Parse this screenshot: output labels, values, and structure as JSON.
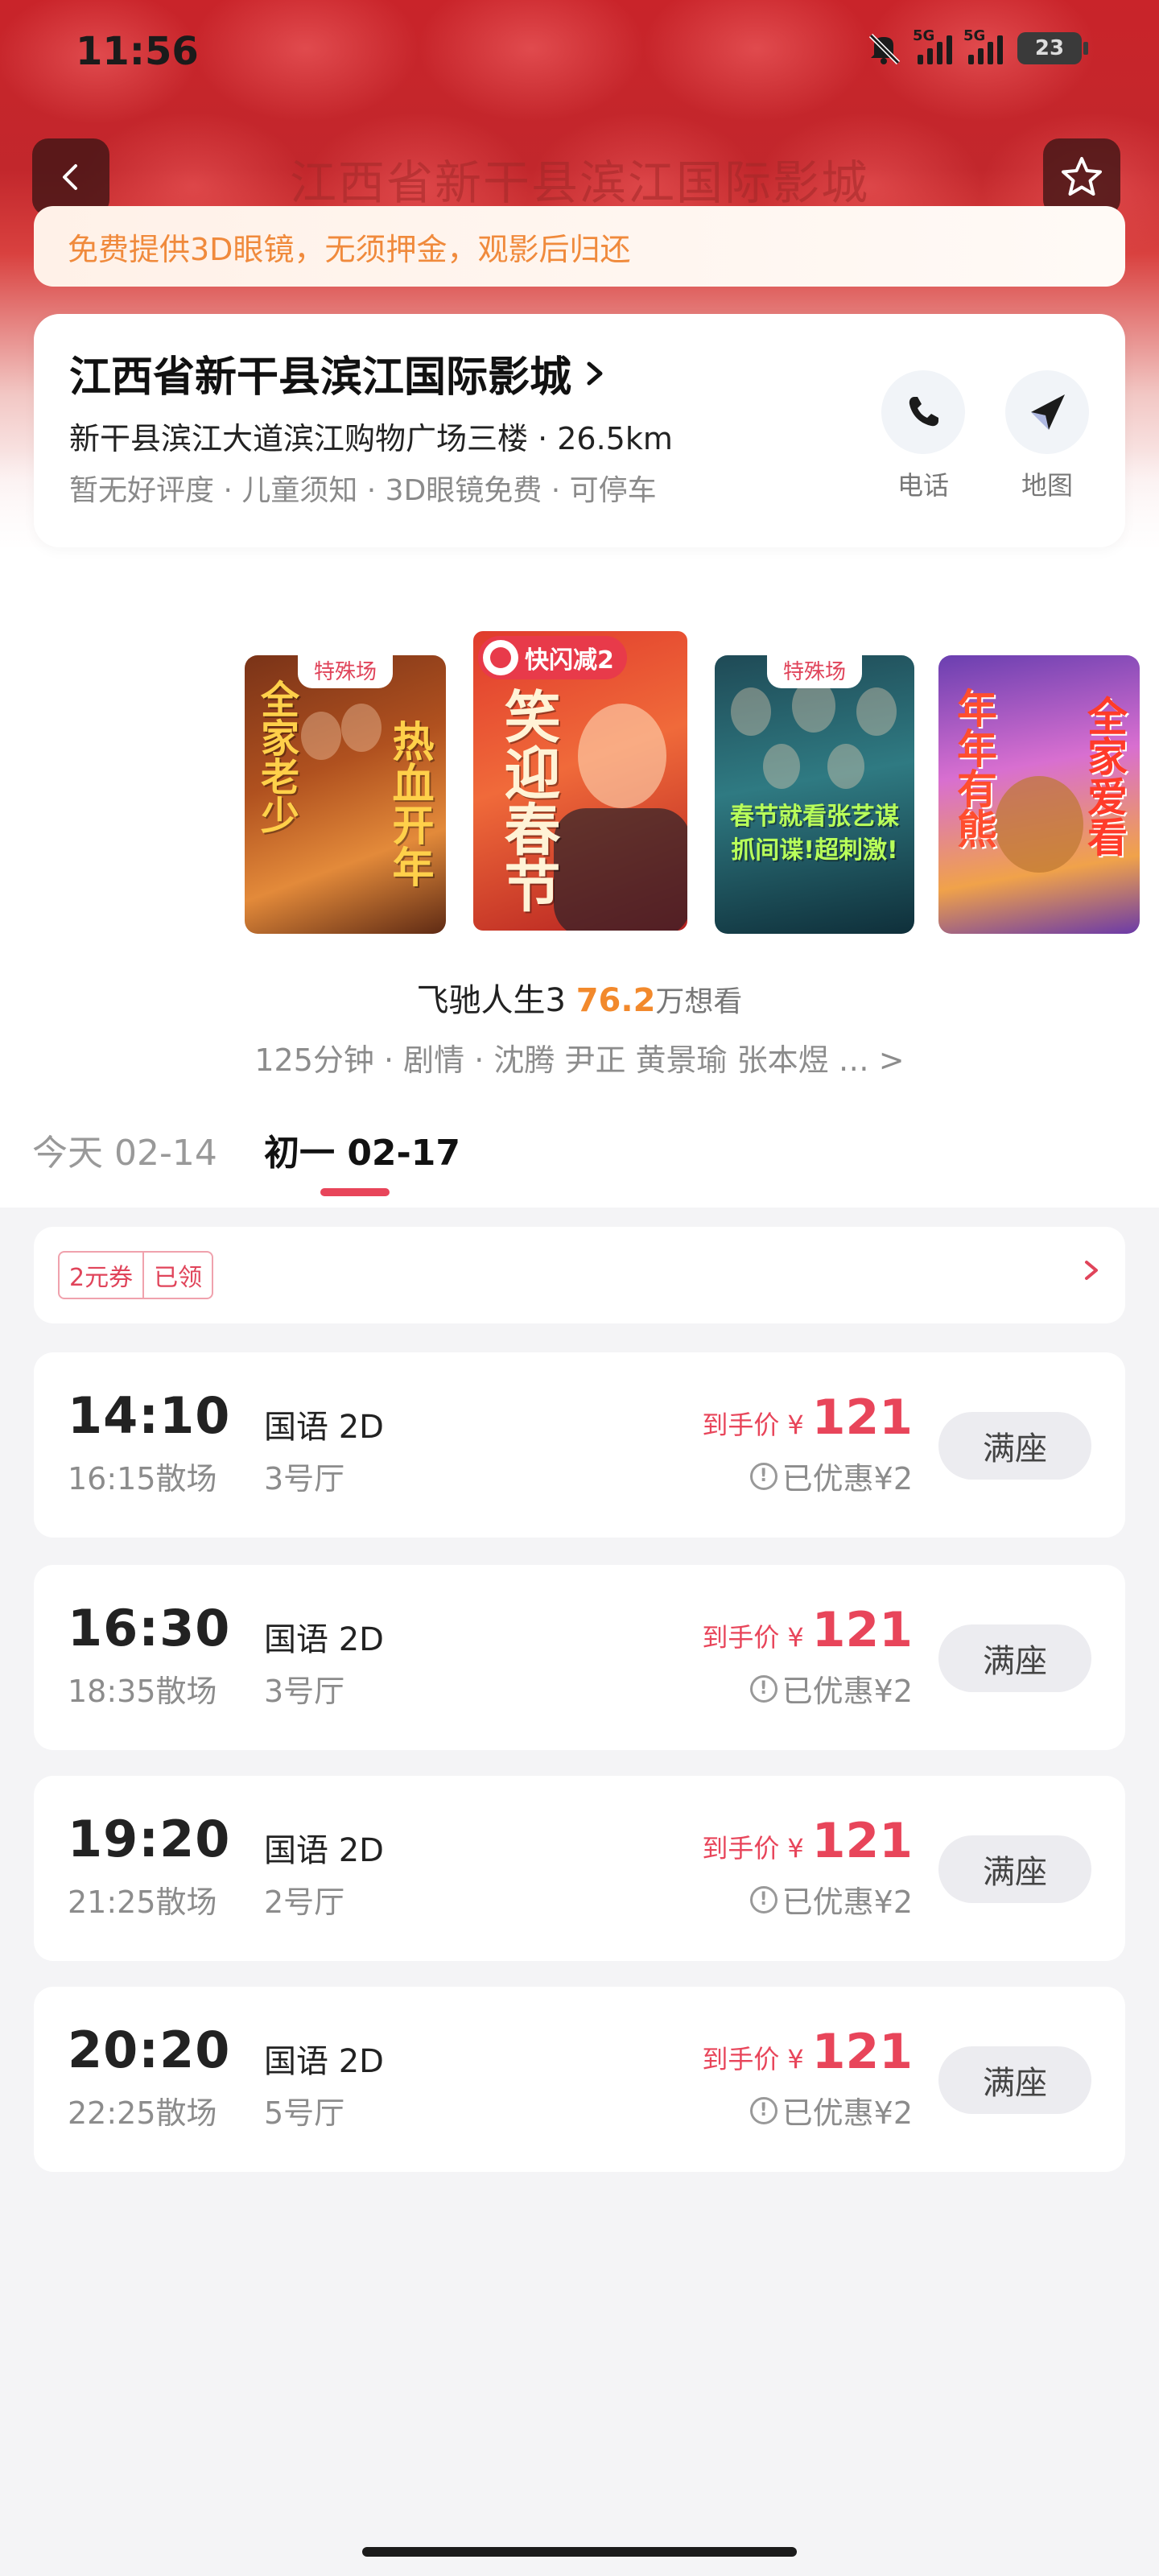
{
  "status": {
    "time": "11:56",
    "battery": "23",
    "sig1": "5G",
    "sig2": "5G"
  },
  "nav": {
    "title": "江西省新干县滨江国际影城"
  },
  "notice": "免费提供3D眼镜，无须押金，观影后归还",
  "cinema": {
    "name": "江西省新干县滨江国际影城",
    "address": "新干县滨江大道滨江购物广场三楼 · 26.5km",
    "tags": "暂无好评度 · 儿童须知 · 3D眼镜免费 · 可停车",
    "phone_label": "电话",
    "map_label": "地图"
  },
  "posters": [
    {
      "badge": "特殊场",
      "text1": "全家老少",
      "text2": "热血开年"
    },
    {
      "promo": "快闪减2",
      "text1": "笑迎春节"
    },
    {
      "badge": "特殊场",
      "text1": "春节就看张艺谋\n抓间谍!超刺激!"
    },
    {
      "text1": "年年有熊",
      "text2": "全家爱看"
    }
  ],
  "movie": {
    "title": "飞驰人生3",
    "score": "76.2",
    "want": "万想看",
    "meta": "125分钟 · 剧情 · 沈腾 尹正 黄景瑜 张本煜 … >"
  },
  "tabs": [
    {
      "label": "今天 02-14"
    },
    {
      "label": "初一 02-17"
    }
  ],
  "coupon": {
    "amount": "2元券",
    "status": "已领"
  },
  "showtimes": [
    {
      "start": "14:10",
      "end": "16:15散场",
      "lang": "国语 2D",
      "hall": "3号厅",
      "price_label": "到手价",
      "currency": "¥",
      "price": "121",
      "discount": "已优惠¥2",
      "status": "满座"
    },
    {
      "start": "16:30",
      "end": "18:35散场",
      "lang": "国语 2D",
      "hall": "3号厅",
      "price_label": "到手价",
      "currency": "¥",
      "price": "121",
      "discount": "已优惠¥2",
      "status": "满座"
    },
    {
      "start": "19:20",
      "end": "21:25散场",
      "lang": "国语 2D",
      "hall": "2号厅",
      "price_label": "到手价",
      "currency": "¥",
      "price": "121",
      "discount": "已优惠¥2",
      "status": "满座"
    },
    {
      "start": "20:20",
      "end": "22:25散场",
      "lang": "国语 2D",
      "hall": "5号厅",
      "price_label": "到手价",
      "currency": "¥",
      "price": "121",
      "discount": "已优惠¥2",
      "status": "满座"
    }
  ],
  "colors": {
    "accent": "#e8455a",
    "score": "#f2892c",
    "notice": "#f08a3c"
  }
}
